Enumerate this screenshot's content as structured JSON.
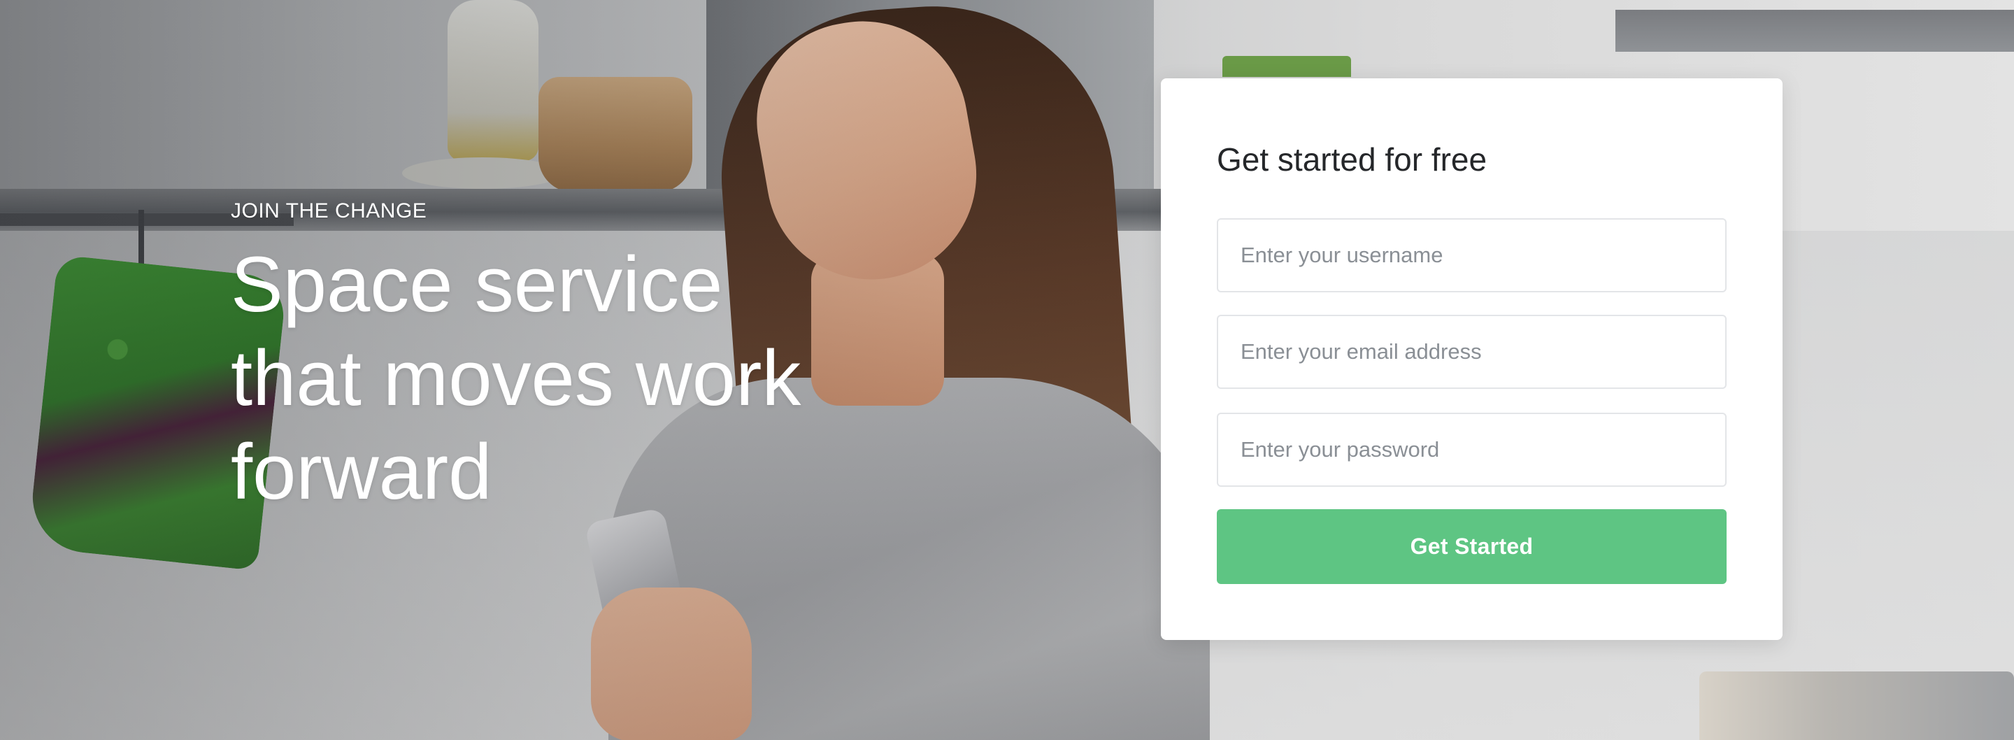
{
  "hero": {
    "eyebrow": "JOIN THE CHANGE",
    "headline_lines": [
      "Space service",
      "that moves work",
      "forward"
    ]
  },
  "signup_card": {
    "title": "Get started for free",
    "username": {
      "value": "",
      "placeholder": "Enter your username"
    },
    "email": {
      "value": "",
      "placeholder": "Enter your email address"
    },
    "password": {
      "value": "",
      "placeholder": "Enter your password"
    },
    "submit_label": "Get Started"
  },
  "colors": {
    "accent": "#5ec583",
    "card_background": "#ffffff",
    "title_text": "#25272a",
    "placeholder_text": "#8a8f95",
    "field_border": "#e3e5e8"
  }
}
